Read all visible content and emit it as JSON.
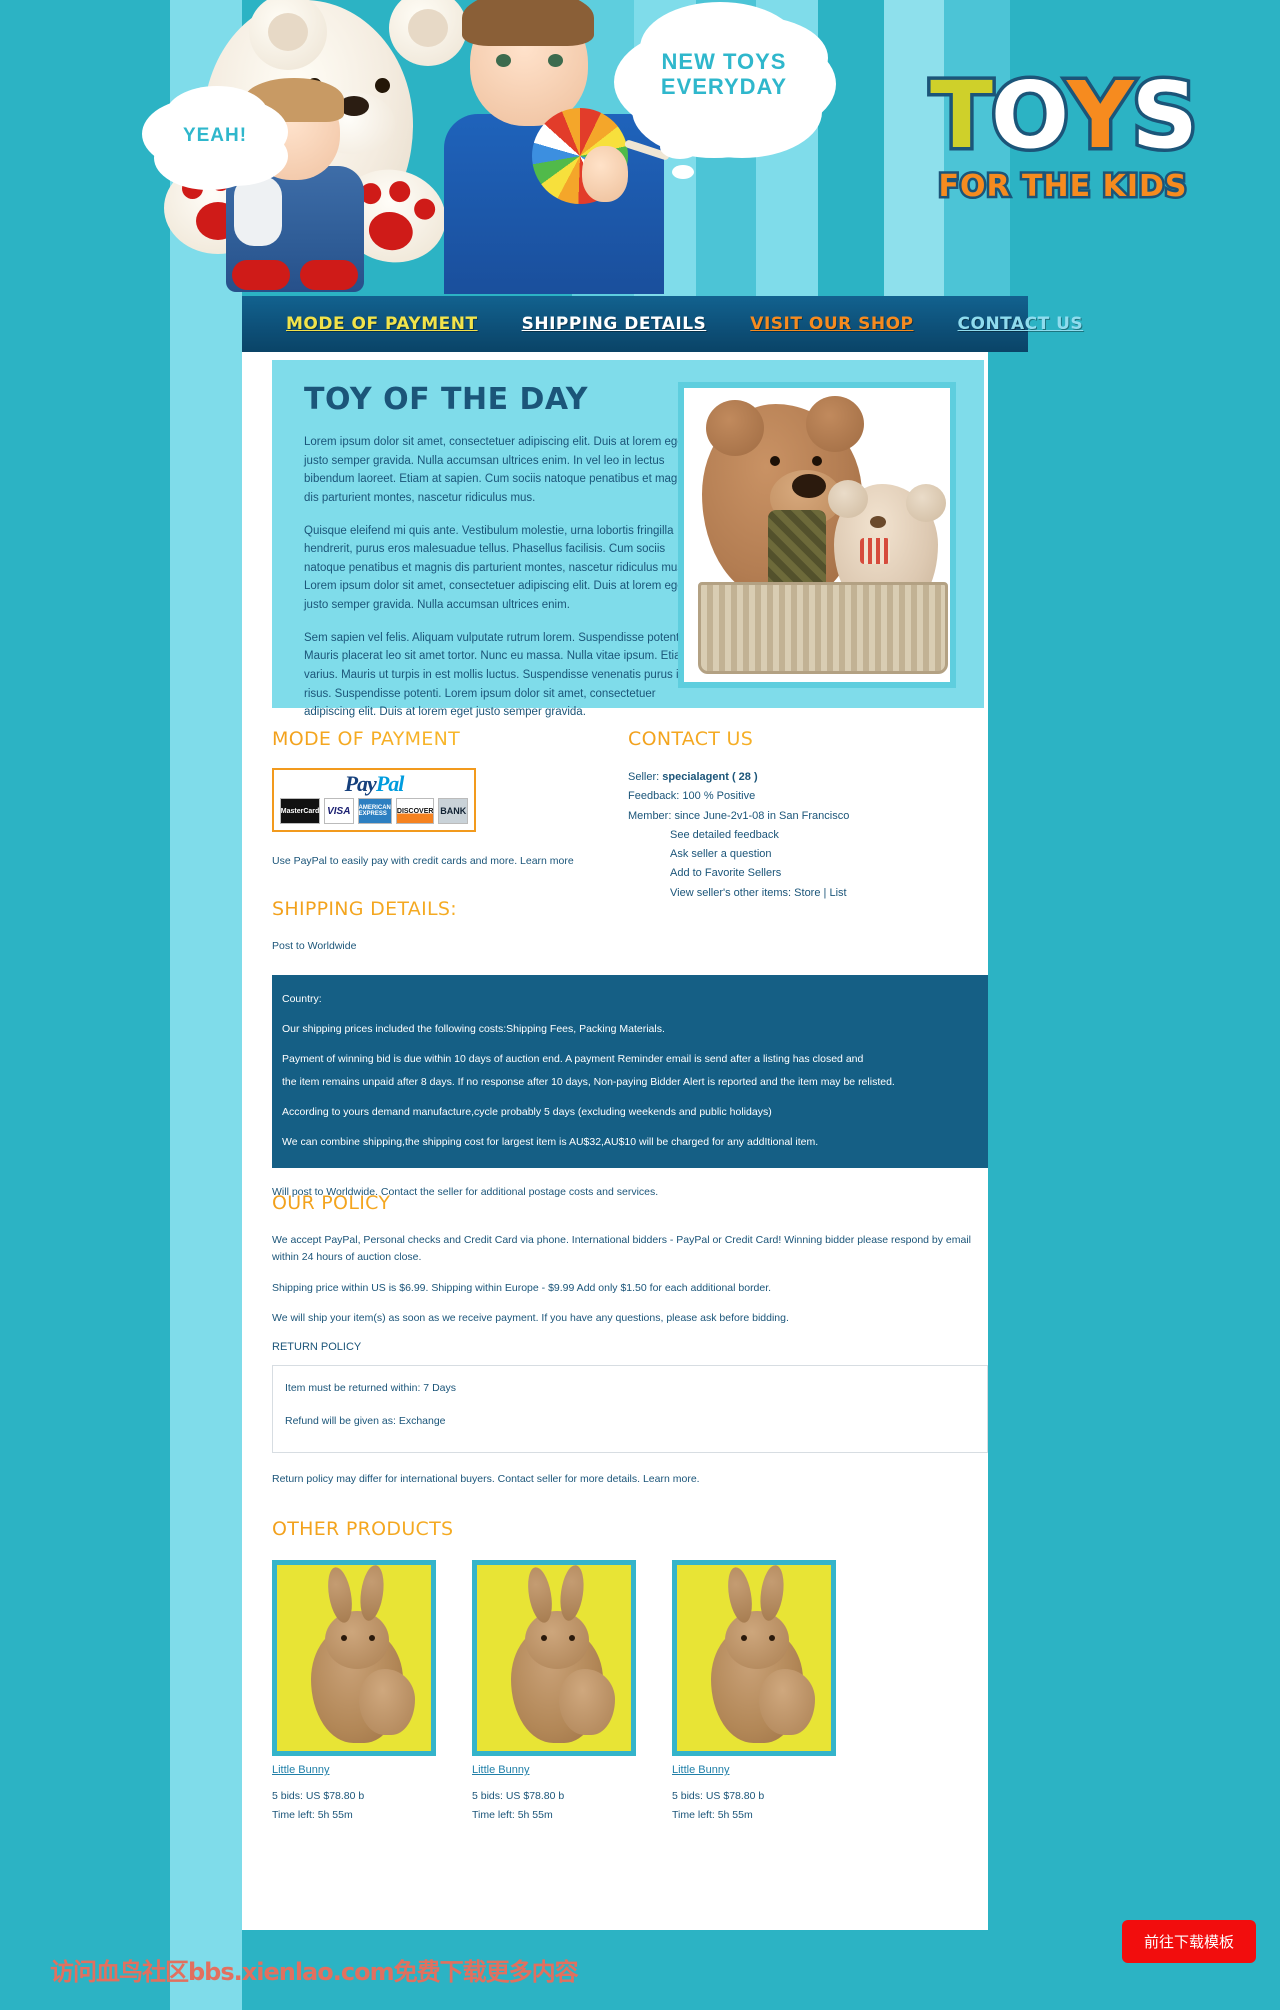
{
  "header": {
    "bubble_yeah": "YEAH!",
    "bubble_new_line1": "NEW TOYS",
    "bubble_new_line2": "EVERYDAY",
    "logo_t": "T",
    "logo_o": "O",
    "logo_y": "Y",
    "logo_s": "S",
    "logo_sub": "FOR THE KIDS",
    "colors": {
      "bg_teal": "#2cb3c4",
      "bg_light_cyan": "#7fdcea",
      "nav_blue": "#0d4f77",
      "accent_orange": "#f2a01b",
      "text_blue": "#1b5579"
    }
  },
  "nav": {
    "items": [
      {
        "label": "MODE OF PAYMENT",
        "color_class": "nv-yellow"
      },
      {
        "label": "SHIPPING DETAILS",
        "color_class": "nv-white"
      },
      {
        "label": "VISIT OUR SHOP",
        "color_class": "nv-orange"
      },
      {
        "label": "CONTACT US",
        "color_class": "nv-cyan"
      }
    ]
  },
  "toy_of_the_day": {
    "title": "TOY OF THE DAY",
    "paragraphs": [
      "Lorem ipsum dolor sit amet, consectetuer adipiscing elit. Duis at lorem eget justo semper gravida. Nulla accumsan ultrices enim. In vel leo in lectus bibendum laoreet. Etiam at sapien. Cum sociis natoque penatibus et magnis dis parturient montes, nascetur ridiculus mus.",
      "Quisque eleifend mi quis ante. Vestibulum molestie, urna lobortis fringilla hendrerit, purus eros malesuadue tellus. Phasellus facilisis. Cum sociis natoque penatibus et magnis dis parturient montes, nascetur ridiculus mus. Lorem ipsum dolor sit amet, consectetuer adipiscing elit. Duis at lorem eget justo semper gravida. Nulla accumsan ultrices enim.",
      "Sem sapien vel felis. Aliquam vulputate rutrum lorem. Suspendisse potenti. Mauris placerat leo sit amet tortor. Nunc eu massa. Nulla vitae ipsum. Etiam varius. Mauris ut turpis in est mollis luctus. Suspendisse venenatis purus id risus. Suspendisse potenti. Lorem ipsum dolor sit amet, consectetuer adipiscing elit. Duis at lorem eget justo semper gravida."
    ],
    "image_alt": "teddy-bears-in-basket"
  },
  "mode_of_payment": {
    "title": "MODE OF PAYMENT",
    "paypal_pay": "Pay",
    "paypal_pal": "Pal",
    "cards": [
      "MasterCard",
      "VISA",
      "AMERICAN EXPRESS",
      "DISCOVER",
      "BANK"
    ],
    "note": "Use PayPal to easily pay with credit cards and more. Learn more"
  },
  "contact_us": {
    "title": "CONTACT US",
    "seller_label": "Seller:",
    "seller_name": "specialagent ( 28 )",
    "feedback": "Feedback: 100 % Positive",
    "member": "Member: since June-2v1-08 in San Francisco",
    "links": [
      "See detailed feedback",
      "Ask seller a question",
      "Add to Favorite Sellers"
    ],
    "other_items_label": "View seller's other items:",
    "other_items_store": "Store",
    "other_items_sep": "|",
    "other_items_list": "List"
  },
  "shipping": {
    "title": "SHIPPING DETAILS:",
    "post_to": "Post to Worldwide",
    "box_lines": [
      "Country:",
      "Our shipping prices included the following costs:Shipping Fees, Packing Materials.",
      "Payment of winning bid is due within 10 days of auction end. A payment Reminder email is send after a listing has closed and",
      "the item remains unpaid after 8 days. If no response after 10 days, Non-paying Bidder Alert is reported and the item may be relisted.",
      "According to yours demand manufacture,cycle probably 5 days (excluding weekends and public holidays)",
      "We can combine shipping,the shipping cost for largest item is AU$32,AU$10 will be charged for any addItional item."
    ],
    "footer_note": "Will post to Worldwide. Contact the seller for additional postage costs and services."
  },
  "policy": {
    "title": "OUR POLICY",
    "paragraphs": [
      "We accept PayPal, Personal checks and Credit Card via phone. International bidders - PayPal or Credit Card! Winning bidder please respond by email within 24 hours of auction close.",
      "Shipping price within US is $6.99. Shipping within Europe - $9.99 Add only $1.50 for each additional border.",
      "We will ship your item(s) as soon as we receive payment. If you have any questions, please ask before bidding."
    ],
    "return_title": "RETURN POLICY",
    "return_within": "Item must be returned within: 7 Days",
    "refund_as": "Refund will be given as: Exchange",
    "footer_note": "Return policy may differ for international buyers. Contact seller for more details. Learn more."
  },
  "other_products": {
    "title": "OTHER PRODUCTS",
    "items": [
      {
        "name": "Little Bunny",
        "bids": "5 bids: US $78.80 b",
        "time_left": "Time left: 5h 55m"
      },
      {
        "name": "Little Bunny",
        "bids": "5 bids: US $78.80 b",
        "time_left": "Time left: 5h 55m"
      },
      {
        "name": "Little Bunny",
        "bids": "5 bids: US $78.80 b",
        "time_left": "Time left: 5h 55m"
      }
    ]
  },
  "footer": {
    "watermark": "访问血鸟社区bbs.xienlao.com免费下载更多内容",
    "download_button": "前往下载模板"
  }
}
